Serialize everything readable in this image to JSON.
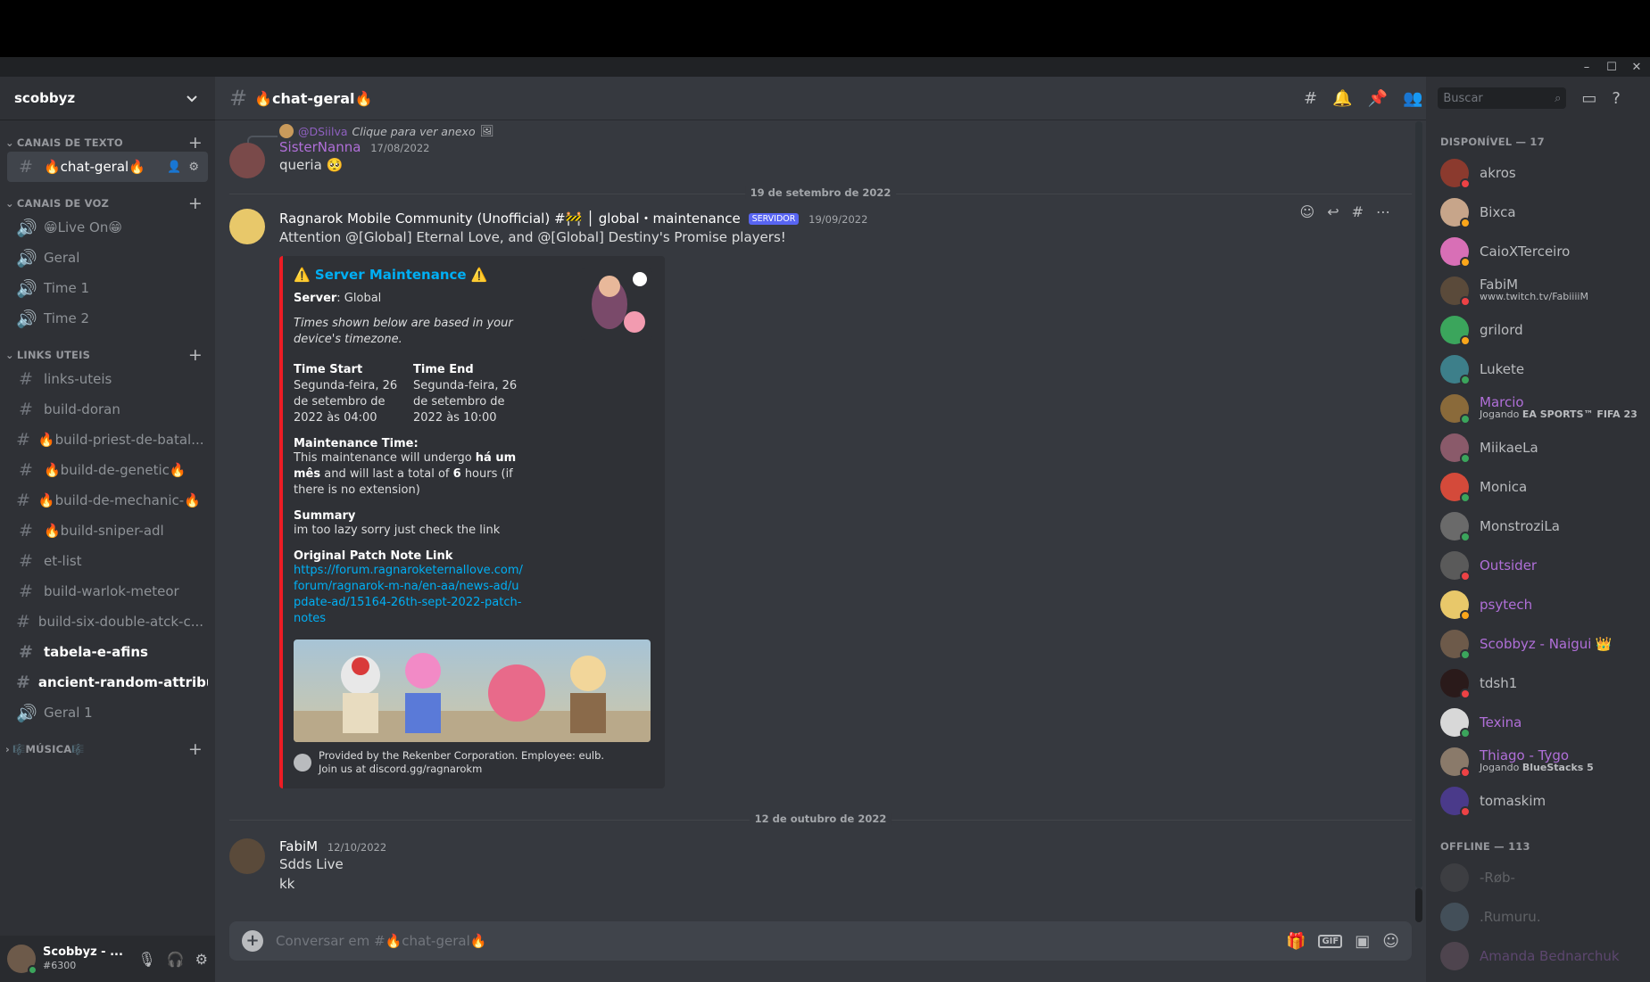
{
  "window": {
    "controls": [
      "–",
      "☐",
      "✕"
    ]
  },
  "server": {
    "name": "scobbyz"
  },
  "categories": {
    "text": "CANAIS DE TEXTO",
    "voice": "CANAIS DE VOZ",
    "links": "LINKS UTEIS",
    "music": "🎼MÚSICA🎼"
  },
  "text_channels": [
    {
      "name": "🔥chat-geral🔥",
      "active": true
    }
  ],
  "voice_channels": [
    "😁Live On😁",
    "Geral",
    "Time 1",
    "Time 2"
  ],
  "link_channels": [
    {
      "name": "links-uteis",
      "icon": "hash"
    },
    {
      "name": "build-doran",
      "icon": "hash"
    },
    {
      "name": "🔥build-priest-de-batal...",
      "icon": "hash"
    },
    {
      "name": "🔥build-de-genetic🔥",
      "icon": "hash"
    },
    {
      "name": "🔥build-de-mechanic-🔥",
      "icon": "hash"
    },
    {
      "name": "🔥build-sniper-adl",
      "icon": "hash"
    },
    {
      "name": "et-list",
      "icon": "hash"
    },
    {
      "name": "build-warlok-meteor",
      "icon": "hash"
    },
    {
      "name": "build-six-double-atck-c...",
      "icon": "hash"
    },
    {
      "name": "tabela-e-afins",
      "icon": "hash",
      "unread": true
    },
    {
      "name": "ancient-random-attribu...",
      "icon": "hash",
      "unread": true
    },
    {
      "name": "Geral 1",
      "icon": "speaker"
    }
  ],
  "user": {
    "name": "Scobbyz - ...",
    "discriminator": "#6300"
  },
  "channel_header": {
    "title": "🔥chat-geral🔥",
    "search_placeholder": "Buscar"
  },
  "messages": {
    "reply_to_name": "@DSiilva",
    "reply_to_text": "Clique para ver anexo",
    "m1": {
      "author": "SisterNanna",
      "timestamp": "17/08/2022",
      "text": "queria 🥺"
    },
    "divider1": "19 de setembro de 2022",
    "m2": {
      "author": "Ragnarok Mobile Community (Unofficial) #🚧 │ global・maintenance",
      "badge": "SERVIDOR",
      "timestamp": "19/09/2022",
      "text": "Attention @[Global] Eternal Love, and @[Global] Destiny's Promise players!"
    },
    "embed": {
      "title": "⚠️ Server Maintenance ⚠️",
      "server_label": "Server",
      "server_value": ": Global",
      "note": "Times shown below are based in your device's timezone.",
      "time_start_label": "Time Start",
      "time_start_value": "Segunda-feira, 26 de setembro de 2022 às 04:00",
      "time_end_label": "Time End",
      "time_end_value": "Segunda-feira, 26 de setembro de 2022 às 10:00",
      "maint_label": "Maintenance Time:",
      "maint_text1": "This maintenance will undergo ",
      "maint_bold1": "há um mês",
      "maint_text2": " and will last a total of ",
      "maint_bold2": "6",
      "maint_text3": " hours (if there is no extension)",
      "summary_label": "Summary",
      "summary_value": "im too lazy sorry just check the link",
      "link_label": "Original Patch Note Link",
      "link_value": "https://forum.ragnaroketernallove.com/forum/ragnarok-m-na/en-aa/news-ad/update-ad/15164-26th-sept-2022-patch-notes",
      "footer_line1": "Provided by the Rekenber Corporation. Employee: eulb.",
      "footer_line2": "Join us at discord.gg/ragnarokm",
      "accent_color": "#ed1c24"
    },
    "divider2": "12 de outubro de 2022",
    "m3": {
      "author": "FabiM",
      "timestamp": "12/10/2022",
      "lines": [
        "Sdds Live",
        "kk"
      ]
    }
  },
  "composer": {
    "placeholder": "Conversar em #🔥chat-geral🔥"
  },
  "members": {
    "online_header": "DISPONÍVEL — 17",
    "offline_header": "OFFLINE — 113",
    "online": [
      {
        "name": "akros",
        "status": "dnd",
        "color": "#8b3a2e"
      },
      {
        "name": "Bixca",
        "status": "idle",
        "color": "#c7a58a"
      },
      {
        "name": "CaioXTerceiro",
        "status": "idle",
        "color": "#d86fb6"
      },
      {
        "name": "FabiM",
        "status": "dnd",
        "activity": "www.twitch.tv/FabiiiiM",
        "color": "#5a4a3a"
      },
      {
        "name": "grilord",
        "status": "idle",
        "color": "#3ba55c",
        "icon": true
      },
      {
        "name": "Lukete",
        "status": "online",
        "color": "#3d7f8a"
      },
      {
        "name": "Marcio",
        "status": "online",
        "purple": true,
        "activity_prefix": "Jogando ",
        "activity_bold": "EA SPORTS™ FIFA 23",
        "color": "#8a6a3a"
      },
      {
        "name": "MiikaeLa",
        "status": "mobile",
        "color": "#8a5a6a"
      },
      {
        "name": "Monica",
        "status": "online",
        "color": "#d44a3a"
      },
      {
        "name": "MonstroziLa",
        "status": "online",
        "color": "#6a6a6a"
      },
      {
        "name": "Outsider",
        "status": "dnd",
        "purple": true,
        "color": "#5a5a5a"
      },
      {
        "name": "psytech",
        "status": "idle",
        "purple": true,
        "color": "#e8c86a"
      },
      {
        "name": "Scobbyz - Naigui",
        "status": "online",
        "purple": true,
        "crown": "👑",
        "color": "#6d5a4a"
      },
      {
        "name": "tdsh1",
        "status": "dnd",
        "color": "#2a1a1a"
      },
      {
        "name": "Texina",
        "status": "online",
        "purple": true,
        "color": "#d8d8d8"
      },
      {
        "name": "Thiago - Tygo",
        "status": "dnd",
        "purple": true,
        "activity_prefix": "Jogando ",
        "activity_bold": "BlueStacks 5",
        "color": "#8a7a6a"
      },
      {
        "name": "tomaskim",
        "status": "dnd",
        "color": "#4a3a8a"
      }
    ],
    "offline": [
      {
        "name": "-Røb-",
        "color": "#5a5a5a"
      },
      {
        "name": ".Rumuru.",
        "color": "#6a8a9a"
      },
      {
        "name": "Amanda Bednarchuk",
        "purple": true,
        "color": "#8a6a7a"
      }
    ]
  },
  "status_colors": {
    "online": "#3ba55c",
    "idle": "#faa61a",
    "dnd": "#ed4245",
    "mobile": "#3ba55c"
  }
}
